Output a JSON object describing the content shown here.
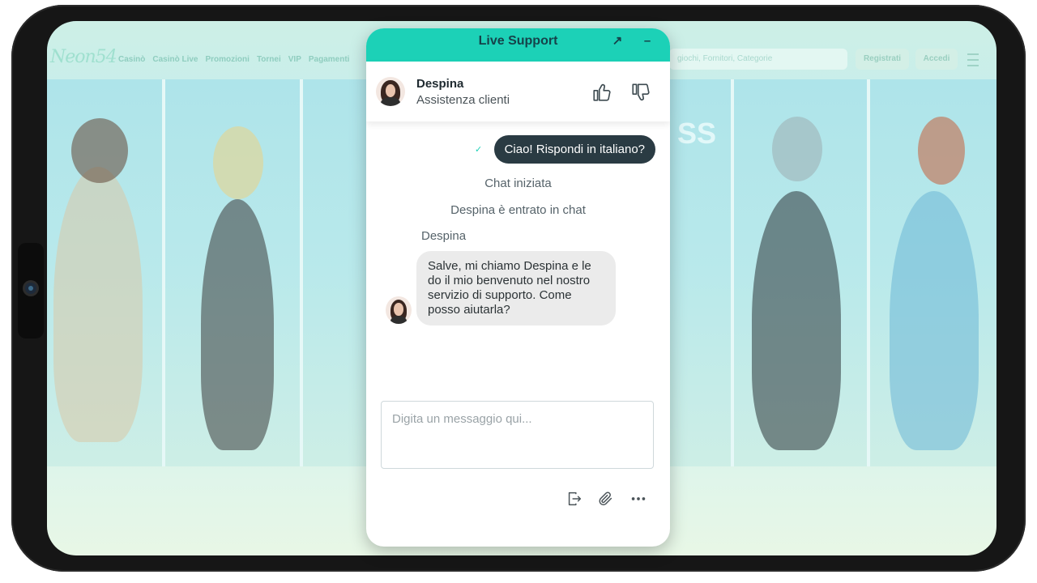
{
  "site": {
    "logo": "Neon54",
    "nav": [
      "Casinò",
      "Casinò Live",
      "Promozioni",
      "Tornei",
      "VIP",
      "Pagamenti"
    ],
    "search_placeholder": "giochi, Fornitori, Categorie",
    "register_label": "Registrati",
    "login_label": "Accedi",
    "promo_text": "SS"
  },
  "chat": {
    "title": "Live Support",
    "popout_icon": "arrow-up-right-icon",
    "minimize_icon": "minimize-icon",
    "agent": {
      "name": "Despina",
      "role": "Assistenza clienti"
    },
    "user_message": "Ciao! Rispondi in italiano?",
    "system_messages": [
      "Chat iniziata",
      "Despina è entrato in chat"
    ],
    "agent_sender": "Despina",
    "agent_message": "Salve, mi chiamo Despina e le do il mio benvenuto nel nostro servizio di supporto. Come posso aiutarla?",
    "input_placeholder": "Digita un messaggio qui...",
    "colors": {
      "header": "#1cd1b7",
      "user_bubble": "#2a3b43",
      "agent_bubble": "#ebebeb"
    }
  }
}
